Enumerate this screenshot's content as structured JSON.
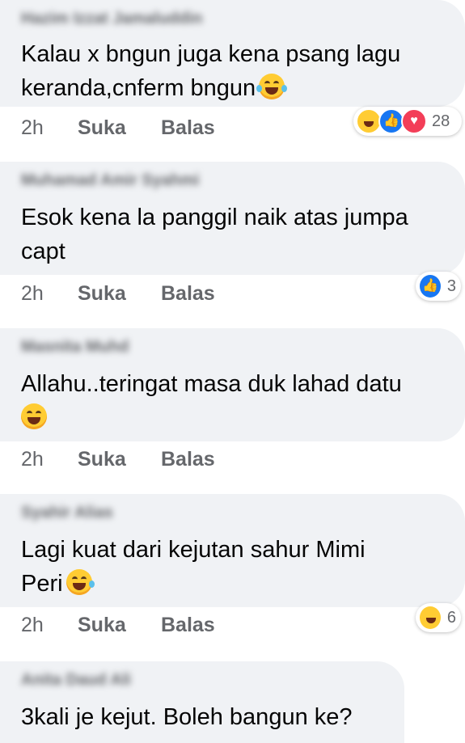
{
  "comments": [
    {
      "author": "Hazim Izzat Jamaluddin",
      "text": "Kalau x bngun juga kena psang lagu\nkeranda,cnferm bngun",
      "emoji": "tears-of-joy-emoji",
      "time": "2h",
      "like_label": "Suka",
      "reply_label": "Balas",
      "reactions": [
        "haha-reaction-icon",
        "like-reaction-icon",
        "love-reaction-icon"
      ],
      "reaction_count": "28"
    },
    {
      "author": "Muhamad Amir Syahmi",
      "text": "Esok kena la panggil naik atas jumpa\ncapt",
      "time": "2h",
      "like_label": "Suka",
      "reply_label": "Balas",
      "reactions": [
        "like-reaction-icon"
      ],
      "reaction_count": "3"
    },
    {
      "author": "Masnita Muhd",
      "text": "Allahu..teringat masa duk lahad datu",
      "emoji": "grinning-sweat-emoji",
      "time": "2h",
      "like_label": "Suka",
      "reply_label": "Balas"
    },
    {
      "author": "Syahir Alias",
      "text": "Lagi kuat dari kejutan sahur Mimi\nPeri",
      "emoji": "rolling-laughing-emoji",
      "time": "2h",
      "like_label": "Suka",
      "reply_label": "Balas",
      "reactions": [
        "haha-reaction-icon"
      ],
      "reaction_count": "6"
    },
    {
      "author": "Anita Daud Ali",
      "text": "3kali je kejut. Boleh bangun ke?"
    }
  ],
  "colors": {
    "bubble": "#f0f2f5",
    "meta": "#65676b",
    "text": "#050505",
    "like": "#1877f2",
    "love": "#f33e58",
    "haha": "#ffcc33"
  }
}
